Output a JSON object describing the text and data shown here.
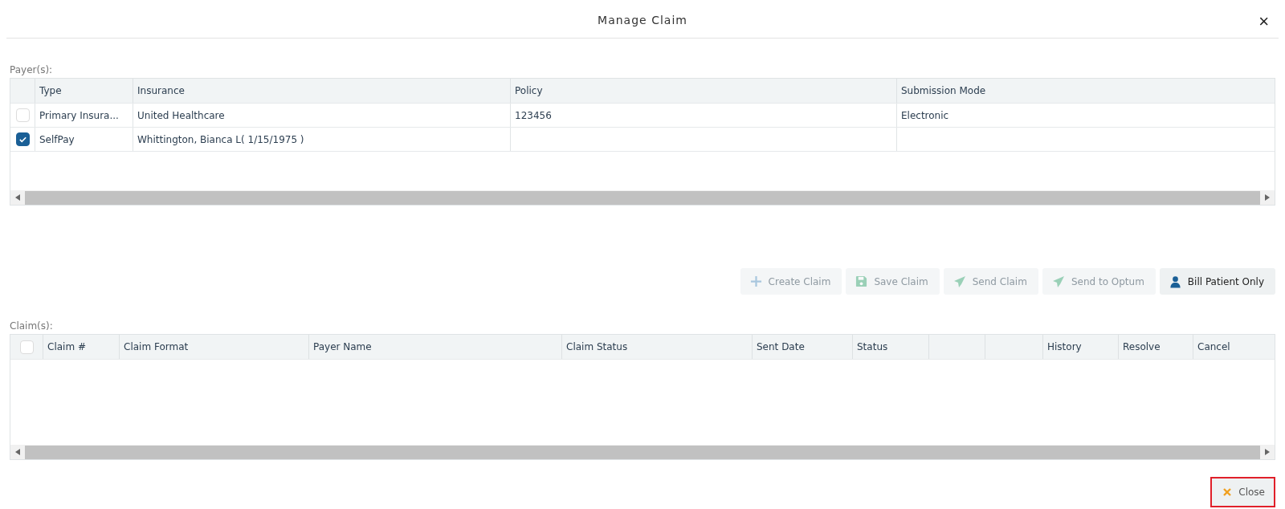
{
  "dialog": {
    "title": "Manage Claim",
    "close_icon": "×"
  },
  "payers": {
    "label": "Payer(s):",
    "columns": [
      "Type",
      "Insurance",
      "Policy",
      "Submission Mode"
    ],
    "rows": [
      {
        "checked": false,
        "type": "Primary Insura...",
        "insurance": "United Healthcare",
        "policy": "123456",
        "mode": "Electronic"
      },
      {
        "checked": true,
        "type": "SelfPay",
        "insurance": "Whittington, Bianca L( 1/15/1975 )",
        "policy": "",
        "mode": ""
      }
    ]
  },
  "actions": [
    {
      "kind": "add",
      "label": "Create Claim",
      "disabled": true
    },
    {
      "kind": "save",
      "label": "Save Claim",
      "disabled": true
    },
    {
      "kind": "send",
      "label": "Send Claim",
      "disabled": true
    },
    {
      "kind": "send",
      "label": "Send to Optum",
      "disabled": true
    },
    {
      "kind": "person",
      "label": "Bill Patient Only",
      "disabled": false
    }
  ],
  "claims": {
    "label": "Claim(s):",
    "select_all_checked": false,
    "columns": [
      "Claim #",
      "Claim Format",
      "Payer Name",
      "Claim Status",
      "Sent Date",
      "Status",
      "History",
      "Resolve",
      "Cancel"
    ]
  },
  "close_button": {
    "label": "Close",
    "highlighted": true
  }
}
